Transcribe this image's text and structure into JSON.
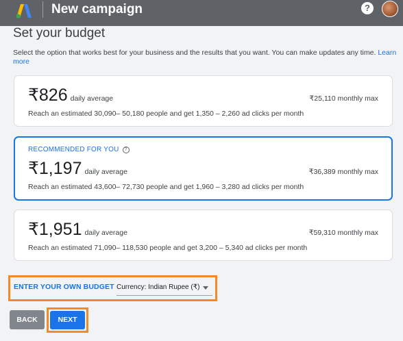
{
  "header": {
    "title": "New campaign",
    "help_icon": "help-circle-icon",
    "logo_icon": "google-ads-logo-icon",
    "help_glyph": "?"
  },
  "page": {
    "title": "Set your budget",
    "intro": "Select the option that works best for your business and the results that you want. You can make updates any time.",
    "learn_more": "Learn more"
  },
  "options": [
    {
      "amount": "₹826",
      "daily_label": "daily average",
      "monthly": "₹25,110 monthly max",
      "reach": "Reach an estimated 30,090– 50,180 people and get 1,350 – 2,260 ad clicks per month"
    },
    {
      "recommended": "RECOMMENDED FOR YOU",
      "amount": "₹1,197",
      "daily_label": "daily average",
      "monthly": "₹36,389 monthly max",
      "reach": "Reach an estimated 43,600– 72,730 people and get 1,960 – 3,280 ad clicks per month"
    },
    {
      "amount": "₹1,951",
      "daily_label": "daily average",
      "monthly": "₹59,310 monthly max",
      "reach": "Reach an estimated 71,090– 118,530 people and get 3,200 – 5,340 ad clicks per month"
    }
  ],
  "own_budget": {
    "label": "ENTER YOUR OWN BUDGET",
    "currency": "Currency: Indian Rupee (₹)"
  },
  "buttons": {
    "back": "BACK",
    "next": "NEXT"
  },
  "colors": {
    "accent": "#1a73e8",
    "header_bg": "#5f6368",
    "highlight": "#f28a28"
  },
  "info_glyph": "?"
}
